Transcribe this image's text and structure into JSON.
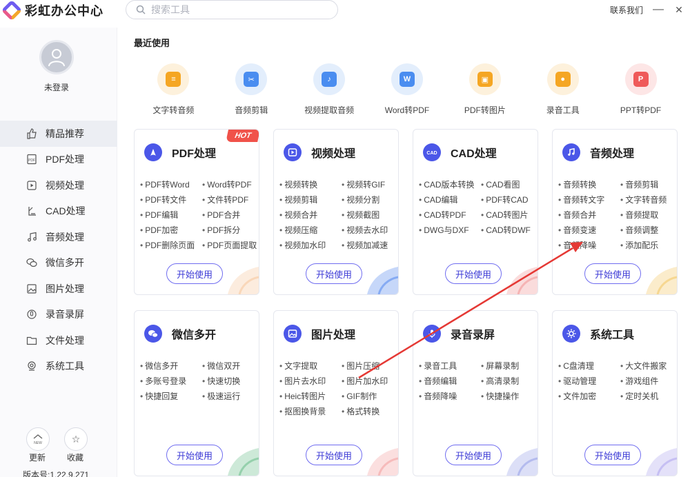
{
  "app": {
    "title": "彩虹办公中心",
    "contact": "联系我们",
    "minimize": "—",
    "close": "✕"
  },
  "search": {
    "placeholder": "搜索工具"
  },
  "user": {
    "login_text": "未登录"
  },
  "sidebar": {
    "items": [
      {
        "label": "精品推荐",
        "icon": "thumbs-up-icon",
        "active": true
      },
      {
        "label": "PDF处理",
        "icon": "pdf-icon"
      },
      {
        "label": "视频处理",
        "icon": "play-icon"
      },
      {
        "label": "CAD处理",
        "icon": "cad-icon"
      },
      {
        "label": "音频处理",
        "icon": "music-note-icon"
      },
      {
        "label": "微信多开",
        "icon": "wechat-icon"
      },
      {
        "label": "图片处理",
        "icon": "image-icon"
      },
      {
        "label": "录音录屏",
        "icon": "microphone-icon"
      },
      {
        "label": "文件处理",
        "icon": "folder-icon"
      },
      {
        "label": "系统工具",
        "icon": "monitor-icon"
      }
    ],
    "update_label": "更新",
    "update_badge": "NEW",
    "favorites_label": "收藏",
    "version": "版本号:1.22.9.271"
  },
  "recent": {
    "title": "最近使用",
    "items": [
      {
        "label": "文字转音频",
        "color": "#f5a623",
        "bg": "#fdf1dc",
        "glyph": "≡"
      },
      {
        "label": "音频剪辑",
        "color": "#4a8df0",
        "bg": "#e3eefc",
        "glyph": "✂"
      },
      {
        "label": "视频提取音频",
        "color": "#4a8df0",
        "bg": "#e3eefc",
        "glyph": "♪"
      },
      {
        "label": "Word转PDF",
        "color": "#4a8df0",
        "bg": "#e3eefc",
        "glyph": "W"
      },
      {
        "label": "PDF转图片",
        "color": "#f5a623",
        "bg": "#fdf1dc",
        "glyph": "▣"
      },
      {
        "label": "录音工具",
        "color": "#f5a623",
        "bg": "#fdf1dc",
        "glyph": "●"
      },
      {
        "label": "PPT转PDF",
        "color": "#ef5a5a",
        "bg": "#fde6e6",
        "glyph": "P"
      }
    ]
  },
  "cards": [
    {
      "title": "PDF处理",
      "icon": "pdf-icon",
      "hot": "HOT",
      "features": [
        "PDF转Word",
        "Word转PDF",
        "PDF转文件",
        "文件转PDF",
        "PDF编辑",
        "PDF合并",
        "PDF加密",
        "PDF拆分",
        "PDF删除页面",
        "PDF页面提取"
      ],
      "button": "开始使用"
    },
    {
      "title": "视频处理",
      "icon": "play-icon",
      "features": [
        "视频转换",
        "视频转GIF",
        "视频剪辑",
        "视频分割",
        "视频合并",
        "视频截图",
        "视频压缩",
        "视频去水印",
        "视频加水印",
        "视频加减速"
      ],
      "button": "开始使用"
    },
    {
      "title": "CAD处理",
      "icon": "cad-icon",
      "features": [
        "CAD版本转换",
        "CAD看图",
        "CAD编辑",
        "PDF转CAD",
        "CAD转PDF",
        "CAD转图片",
        "DWG与DXF",
        "CAD转DWF"
      ],
      "button": "开始使用"
    },
    {
      "title": "音频处理",
      "icon": "music-note-icon",
      "features": [
        "音频转换",
        "音频剪辑",
        "音频转文字",
        "文字转音频",
        "音频合并",
        "音频提取",
        "音频变速",
        "音频调整",
        "音频降噪",
        "添加配乐"
      ],
      "button": "开始使用"
    },
    {
      "title": "微信多开",
      "icon": "wechat-icon",
      "features": [
        "微信多开",
        "微信双开",
        "多账号登录",
        "快速切换",
        "快捷回复",
        "极速运行"
      ],
      "button": "开始使用"
    },
    {
      "title": "图片处理",
      "icon": "image-icon",
      "features": [
        "文字提取",
        "图片压缩",
        "图片去水印",
        "图片加水印",
        "Heic转图片",
        "GIF制作",
        "抠图换背景",
        "格式转换"
      ],
      "button": "开始使用"
    },
    {
      "title": "录音录屏",
      "icon": "microphone-icon",
      "features": [
        "录音工具",
        "屏幕录制",
        "音频编辑",
        "高清录制",
        "音频降噪",
        "快捷操作"
      ],
      "button": "开始使用"
    },
    {
      "title": "系统工具",
      "icon": "gear-icon",
      "features": [
        "C盘清理",
        "大文件搬家",
        "驱动管理",
        "游戏组件",
        "文件加密",
        "定时关机"
      ],
      "button": "开始使用"
    }
  ],
  "colors": {
    "accent": "#4b57e8",
    "button_text": "#3d3bd6",
    "hot": "#f0524a",
    "annotation_arrow": "#e53935"
  }
}
